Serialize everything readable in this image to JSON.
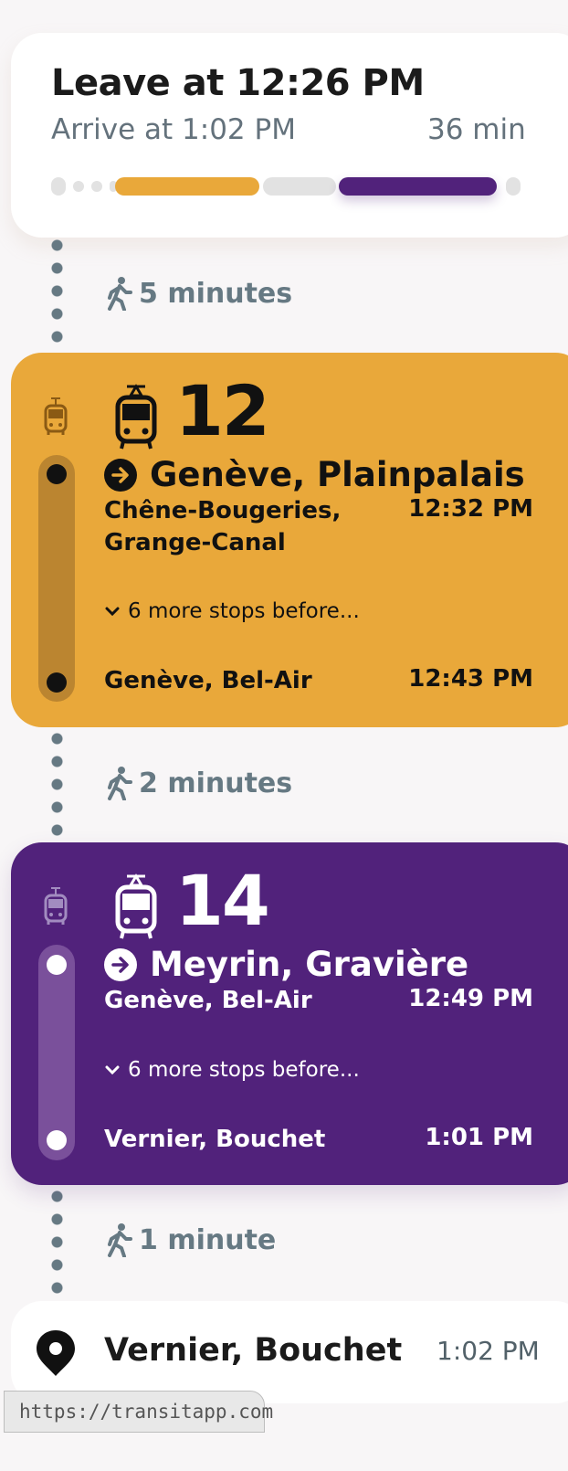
{
  "summary": {
    "leave": "Leave at 12:26 PM",
    "arrive": "Arrive at 1:02 PM",
    "duration": "36 min",
    "colors": {
      "route12": "#e9a83a",
      "route14": "#51227b",
      "walk": "#e2e2e2"
    }
  },
  "walks": [
    {
      "text": "5 minutes",
      "icon": "walking-person-icon"
    },
    {
      "text": "2 minutes",
      "icon": "walking-person-icon"
    },
    {
      "text": "1 minute",
      "icon": "walking-person-icon"
    }
  ],
  "legs": [
    {
      "route": "12",
      "icon": "tram-icon",
      "color": "#e9a83a",
      "destination": "Genève, Plainpalais",
      "board_stop": "Chêne-Bougeries, Grange-Canal",
      "board_stop_line1": "Chêne-Bougeries,",
      "board_stop_line2": "Grange-Canal",
      "board_time": "12:32 PM",
      "more_stops": "6 more stops before...",
      "alight_stop": "Genève, Bel-Air",
      "alight_time": "12:43 PM"
    },
    {
      "route": "14",
      "icon": "tram-icon",
      "color": "#51227b",
      "destination": "Meyrin, Gravière",
      "board_stop": "Genève, Bel-Air",
      "board_time": "12:49 PM",
      "more_stops": "6 more stops before...",
      "alight_stop": "Vernier, Bouchet",
      "alight_time": "1:01 PM"
    }
  ],
  "destination": {
    "name": "Vernier, Bouchet",
    "time": "1:02 PM",
    "icon": "map-pin-icon"
  },
  "status_url": "https://transitapp.com"
}
